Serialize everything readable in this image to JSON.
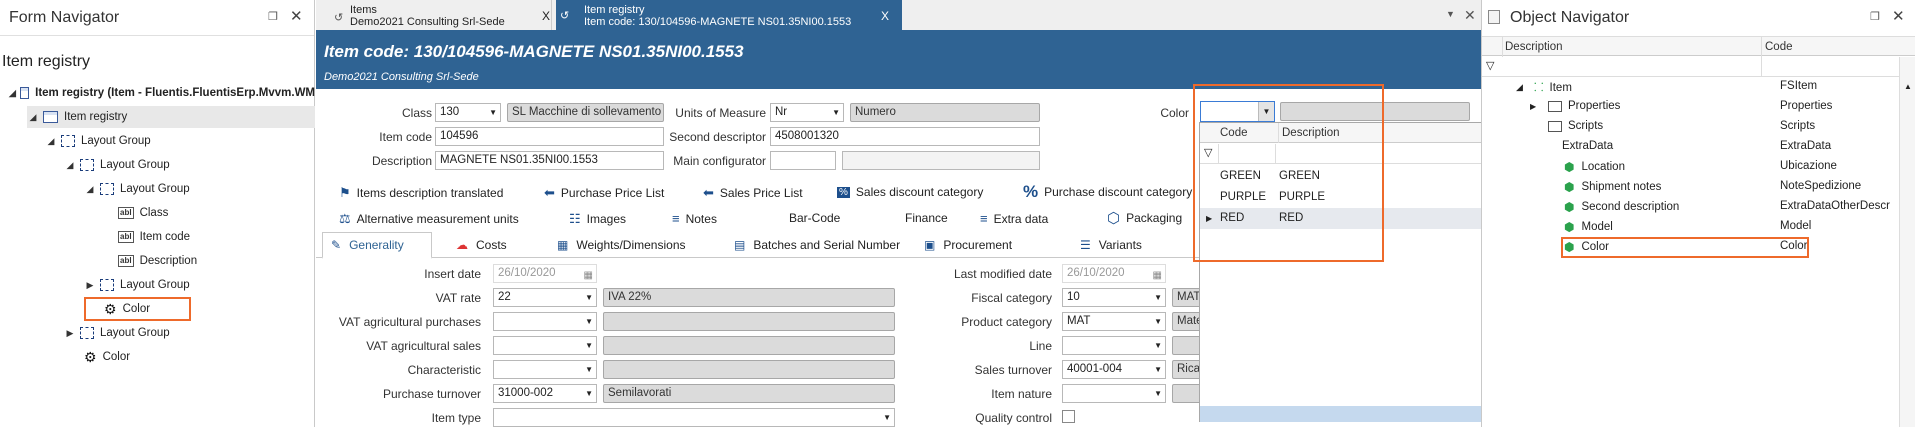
{
  "form_navigator": {
    "title": "Form Navigator",
    "heading": "Item registry",
    "tree": [
      {
        "label": "Item registry (Item - Fluentis.FluentisErp.Mvvm.WM"
      },
      {
        "label": "Item registry"
      },
      {
        "label": "Layout Group"
      },
      {
        "label": "Layout Group"
      },
      {
        "label": "Layout Group"
      },
      {
        "label": "Class"
      },
      {
        "label": "Item code"
      },
      {
        "label": "Description"
      },
      {
        "label": "Layout Group"
      },
      {
        "label": "Color"
      },
      {
        "label": "Layout Group"
      },
      {
        "label": "Color"
      }
    ]
  },
  "tabs": [
    {
      "line1": "Items",
      "line2": "Demo2021 Consulting Srl-Sede",
      "close": "X"
    },
    {
      "line1": "Item registry",
      "line2": "Item code: 130/104596-MAGNETE NS01.35NI00.1553",
      "close": "X"
    }
  ],
  "header": {
    "title": "Item code: 130/104596-MAGNETE NS01.35NI00.1553",
    "subtitle": "Demo2021 Consulting Srl-Sede"
  },
  "form": {
    "class_label": "Class",
    "class_value": "130",
    "class_desc": "SL Macchine di sollevamento",
    "uom_label": "Units of Measure",
    "uom_value": "Nr",
    "uom_desc": "Numero",
    "color_label": "Color",
    "item_code_label": "Item code",
    "item_code_value": "104596",
    "second_desc_label": "Second descriptor",
    "second_desc_value": "4508001320",
    "description_label": "Description",
    "description_value": "MAGNETE NS01.35NI00.1553",
    "main_config_label": "Main configurator"
  },
  "toolbar": [
    {
      "icon": "flag-icon",
      "label": "Items description translated"
    },
    {
      "icon": "price-tag-icon",
      "label": "Purchase Price List"
    },
    {
      "icon": "price-tag-icon",
      "label": "Sales Price List"
    },
    {
      "icon": "percent-icon",
      "label": "Sales discount category"
    },
    {
      "icon": "percent-icon",
      "label": "Purchase discount category"
    },
    {
      "icon": "scales-icon",
      "label": "Alternative measurement units"
    },
    {
      "icon": "images-icon",
      "label": "Images"
    },
    {
      "icon": "notes-icon",
      "label": "Notes"
    },
    {
      "icon": "",
      "label": "Bar-Code"
    },
    {
      "icon": "",
      "label": "Finance"
    },
    {
      "icon": "extra-data-icon",
      "label": "Extra data"
    },
    {
      "icon": "packaging-icon",
      "label": "Packaging"
    }
  ],
  "subtabs": [
    {
      "label": "Generality"
    },
    {
      "label": "Costs"
    },
    {
      "label": "Weights/Dimensions"
    },
    {
      "label": "Batches and Serial Number"
    },
    {
      "label": "Procurement"
    },
    {
      "label": "Variants"
    }
  ],
  "general": {
    "insert_date_label": "Insert date",
    "insert_date_value": "26/10/2020",
    "vat_rate_label": "VAT rate",
    "vat_rate_value": "22",
    "vat_rate_desc": "IVA 22%",
    "vat_agri_purch_label": "VAT agricultural purchases",
    "vat_agri_sales_label": "VAT agricultural sales",
    "characteristic_label": "Characteristic",
    "purchase_turnover_label": "Purchase turnover",
    "purchase_turnover_value": "31000-002",
    "purchase_turnover_desc": "Semilavorati",
    "item_type_label": "Item type",
    "last_modified_label": "Last modified date",
    "last_modified_value": "26/10/2020",
    "fiscal_category_label": "Fiscal category",
    "fiscal_category_value": "10",
    "fiscal_category_desc": "MAT",
    "product_category_label": "Product category",
    "product_category_value": "MAT",
    "product_category_desc": "Mate",
    "line_label": "Line",
    "sales_turnover_label": "Sales turnover",
    "sales_turnover_value": "40001-004",
    "sales_turnover_desc": "Rica",
    "item_nature_label": "Item nature",
    "quality_control_label": "Quality control"
  },
  "color_dropdown": {
    "col_code": "Code",
    "col_desc": "Description",
    "rows": [
      {
        "code": "GREEN",
        "desc": "GREEN"
      },
      {
        "code": "PURPLE",
        "desc": "PURPLE"
      },
      {
        "code": "RED",
        "desc": "RED"
      }
    ]
  },
  "object_navigator": {
    "title": "Object Navigator",
    "col_desc": "Description",
    "col_code": "Code",
    "rows": [
      {
        "desc": "Item",
        "code": "FSItem"
      },
      {
        "desc": "Properties",
        "code": "Properties"
      },
      {
        "desc": "Scripts",
        "code": "Scripts"
      },
      {
        "desc": "ExtraData",
        "code": "ExtraData"
      },
      {
        "desc": "Location",
        "code": "Ubicazione"
      },
      {
        "desc": "Shipment notes",
        "code": "NoteSpedizione"
      },
      {
        "desc": "Second description",
        "code": "ExtraDataOtherDescr"
      },
      {
        "desc": "Model",
        "code": "Model"
      },
      {
        "desc": "Color",
        "code": "Color"
      }
    ]
  },
  "colors": {
    "header_bg": "#2f6393",
    "accent": "#ee6a2b",
    "tab_active": "#2f6393"
  }
}
